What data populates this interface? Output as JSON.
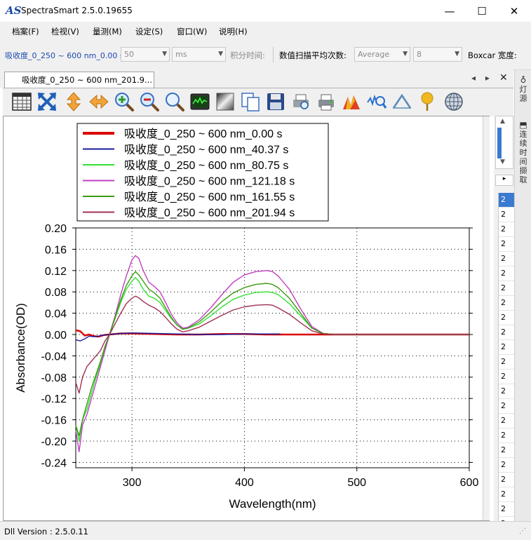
{
  "window": {
    "title": "SpectraSmart 2.5.0.19655",
    "icon_text": "AS",
    "controls": {
      "minimize": "—",
      "maximize": "☐",
      "close": "✕"
    }
  },
  "menu": [
    "档案(F)",
    "检视(V)",
    "量测(M)",
    "设定(S)",
    "窗口(W)",
    "说明(H)"
  ],
  "params": {
    "spectrum_name": "吸收度_0_250 ~ 600 nm_0.00 s",
    "integration_value": "50",
    "integration_unit": "ms",
    "integration_label": "积分时间:",
    "averaging_label": "数值扫描平均次数:",
    "average_mode": "Average",
    "average_count": "8",
    "boxcar_label": "Boxcar 宽度:"
  },
  "document_tab": {
    "label": "吸收度_0_250 ~ 600 nm_201.9...",
    "nav_left": "◂",
    "nav_right": "▸",
    "close": "✕"
  },
  "toolbar_icons": [
    "grid-table-icon",
    "fit-all-icon",
    "vertical-scale-icon",
    "horizontal-scale-icon",
    "zoom-in-icon",
    "zoom-out-icon",
    "zoom-reset-icon",
    "oscilloscope-icon",
    "gradient-icon",
    "copy-icon",
    "save-icon",
    "print-preview-icon",
    "print-icon",
    "peak-color-icon",
    "peak-search-icon",
    "baseline-icon",
    "marker-pin-icon",
    "globe-grid-icon"
  ],
  "right_panel": {
    "tab_light_source": "灯源",
    "tab_continuous_capture": "连续时间撷取",
    "list_values": [
      "2",
      "2",
      "2",
      "2",
      "2",
      "2",
      "2",
      "2",
      "2",
      "2",
      "2",
      "2",
      "2",
      "2",
      "2",
      "2",
      "2",
      "2",
      "2",
      "2",
      "2",
      "2",
      "2"
    ]
  },
  "status": {
    "dll_version": "Dll Version : 2.5.0.11"
  },
  "chart_data": {
    "type": "line",
    "xlabel": "Wavelength(nm)",
    "ylabel": "Absorbance(OD)",
    "xlim": [
      250,
      600
    ],
    "ylim": [
      -0.25,
      0.2
    ],
    "xticks": [
      300,
      400,
      500,
      600
    ],
    "yticks": [
      0.2,
      0.16,
      0.12,
      0.08,
      0.04,
      0.0,
      -0.04,
      -0.08,
      -0.12,
      -0.16,
      -0.2,
      -0.24
    ],
    "grid": true,
    "legend_position": "top-left",
    "series": [
      {
        "name": "吸收度_0_250  ~  600 nm_0.00 s",
        "color": "#dd0000",
        "x": [
          250,
          254,
          258,
          262,
          266,
          270,
          275,
          280,
          290,
          300,
          320,
          340,
          360,
          380,
          400,
          420,
          440,
          460,
          480,
          500,
          520,
          540,
          560,
          580,
          600
        ],
        "y": [
          0.008,
          0.006,
          -0.002,
          0.0,
          -0.003,
          -0.004,
          -0.001,
          0.0,
          0.002,
          0.002,
          0.001,
          0.0,
          0.0,
          0.001,
          0.001,
          0.0,
          0.0,
          0.0,
          0.0,
          0.0,
          0.0,
          0.0,
          0.0,
          0.0,
          0.0
        ]
      },
      {
        "name": "吸收度_0_250  ~  600 nm_40.37 s",
        "color": "#1a1a9a",
        "x": [
          250,
          254,
          258,
          262,
          266,
          270,
          275,
          280,
          290,
          300,
          320,
          340,
          360,
          380,
          400,
          420,
          432
        ],
        "y": [
          -0.01,
          -0.012,
          -0.008,
          -0.003,
          -0.004,
          -0.003,
          -0.001,
          0.0,
          0.002,
          0.003,
          0.002,
          0.001,
          0.0,
          0.0,
          0.001,
          0.001,
          0.001
        ]
      },
      {
        "name": "吸收度_0_250  ~  600 nm_80.75 s",
        "color": "#33e033",
        "x": [
          250,
          253,
          256,
          260,
          264,
          268,
          272,
          276,
          280,
          285,
          290,
          295,
          300,
          303,
          306,
          310,
          315,
          320,
          325,
          330,
          335,
          340,
          345,
          350,
          360,
          370,
          380,
          390,
          400,
          410,
          420,
          425,
          430,
          440,
          450,
          460,
          470,
          480,
          500,
          520,
          540,
          560,
          580,
          600
        ],
        "y": [
          -0.17,
          -0.2,
          -0.16,
          -0.14,
          -0.11,
          -0.08,
          -0.055,
          -0.025,
          0.0,
          0.03,
          0.06,
          0.085,
          0.1,
          0.107,
          0.1,
          0.085,
          0.072,
          0.068,
          0.06,
          0.045,
          0.03,
          0.018,
          0.01,
          0.012,
          0.02,
          0.035,
          0.052,
          0.066,
          0.074,
          0.079,
          0.08,
          0.079,
          0.075,
          0.058,
          0.035,
          0.012,
          0.002,
          0.0,
          0.0,
          0.0,
          0.0,
          0.0,
          0.0,
          0.0
        ]
      },
      {
        "name": "吸收度_0_250  ~  600 nm_121.18 s",
        "color": "#c040c0",
        "x": [
          250,
          253,
          256,
          260,
          264,
          268,
          272,
          276,
          280,
          285,
          290,
          295,
          300,
          303,
          306,
          310,
          315,
          320,
          325,
          330,
          335,
          340,
          345,
          350,
          360,
          370,
          380,
          390,
          400,
          410,
          420,
          425,
          430,
          440,
          450,
          460,
          470,
          480,
          500,
          520,
          540,
          560,
          580,
          600
        ],
        "y": [
          -0.18,
          -0.22,
          -0.17,
          -0.15,
          -0.12,
          -0.09,
          -0.06,
          -0.03,
          0.0,
          0.035,
          0.075,
          0.11,
          0.14,
          0.148,
          0.143,
          0.12,
          0.098,
          0.09,
          0.08,
          0.06,
          0.038,
          0.022,
          0.012,
          0.014,
          0.028,
          0.05,
          0.075,
          0.098,
          0.112,
          0.118,
          0.12,
          0.118,
          0.11,
          0.085,
          0.048,
          0.015,
          0.002,
          0.0,
          0.0,
          0.0,
          0.0,
          0.0,
          0.0,
          0.0
        ]
      },
      {
        "name": "吸收度_0_250  ~  600 nm_161.55 s",
        "color": "#3a9a10",
        "x": [
          250,
          253,
          256,
          260,
          264,
          268,
          272,
          276,
          280,
          285,
          290,
          295,
          300,
          303,
          306,
          310,
          315,
          320,
          325,
          330,
          335,
          340,
          345,
          350,
          360,
          370,
          380,
          390,
          400,
          410,
          420,
          425,
          430,
          440,
          450,
          460,
          470,
          480,
          500,
          520,
          540,
          560,
          580,
          600
        ],
        "y": [
          -0.17,
          -0.19,
          -0.16,
          -0.13,
          -0.1,
          -0.075,
          -0.05,
          -0.022,
          0.0,
          0.032,
          0.065,
          0.092,
          0.11,
          0.118,
          0.112,
          0.1,
          0.085,
          0.078,
          0.068,
          0.05,
          0.032,
          0.018,
          0.01,
          0.012,
          0.024,
          0.042,
          0.062,
          0.078,
          0.088,
          0.094,
          0.096,
          0.094,
          0.088,
          0.068,
          0.04,
          0.012,
          0.002,
          0.0,
          0.0,
          0.0,
          0.0,
          0.0,
          0.0,
          0.0
        ]
      },
      {
        "name": "吸收度_0_250  ~  600 nm_201.94 s",
        "color": "#a03050",
        "x": [
          250,
          253,
          256,
          260,
          264,
          268,
          272,
          276,
          280,
          285,
          290,
          295,
          300,
          303,
          306,
          310,
          315,
          320,
          325,
          330,
          335,
          340,
          345,
          350,
          360,
          370,
          380,
          390,
          400,
          410,
          420,
          425,
          430,
          440,
          450,
          460,
          470,
          480,
          500,
          520,
          540,
          560,
          580,
          600
        ],
        "y": [
          -0.09,
          -0.11,
          -0.08,
          -0.06,
          -0.05,
          -0.04,
          -0.03,
          -0.012,
          0.0,
          0.02,
          0.04,
          0.058,
          0.068,
          0.072,
          0.069,
          0.062,
          0.055,
          0.05,
          0.043,
          0.032,
          0.02,
          0.01,
          0.005,
          0.007,
          0.014,
          0.025,
          0.036,
          0.046,
          0.052,
          0.055,
          0.056,
          0.055,
          0.05,
          0.038,
          0.022,
          0.007,
          0.001,
          0.0,
          0.0,
          0.0,
          0.0,
          0.0,
          0.0,
          0.0
        ]
      }
    ]
  }
}
